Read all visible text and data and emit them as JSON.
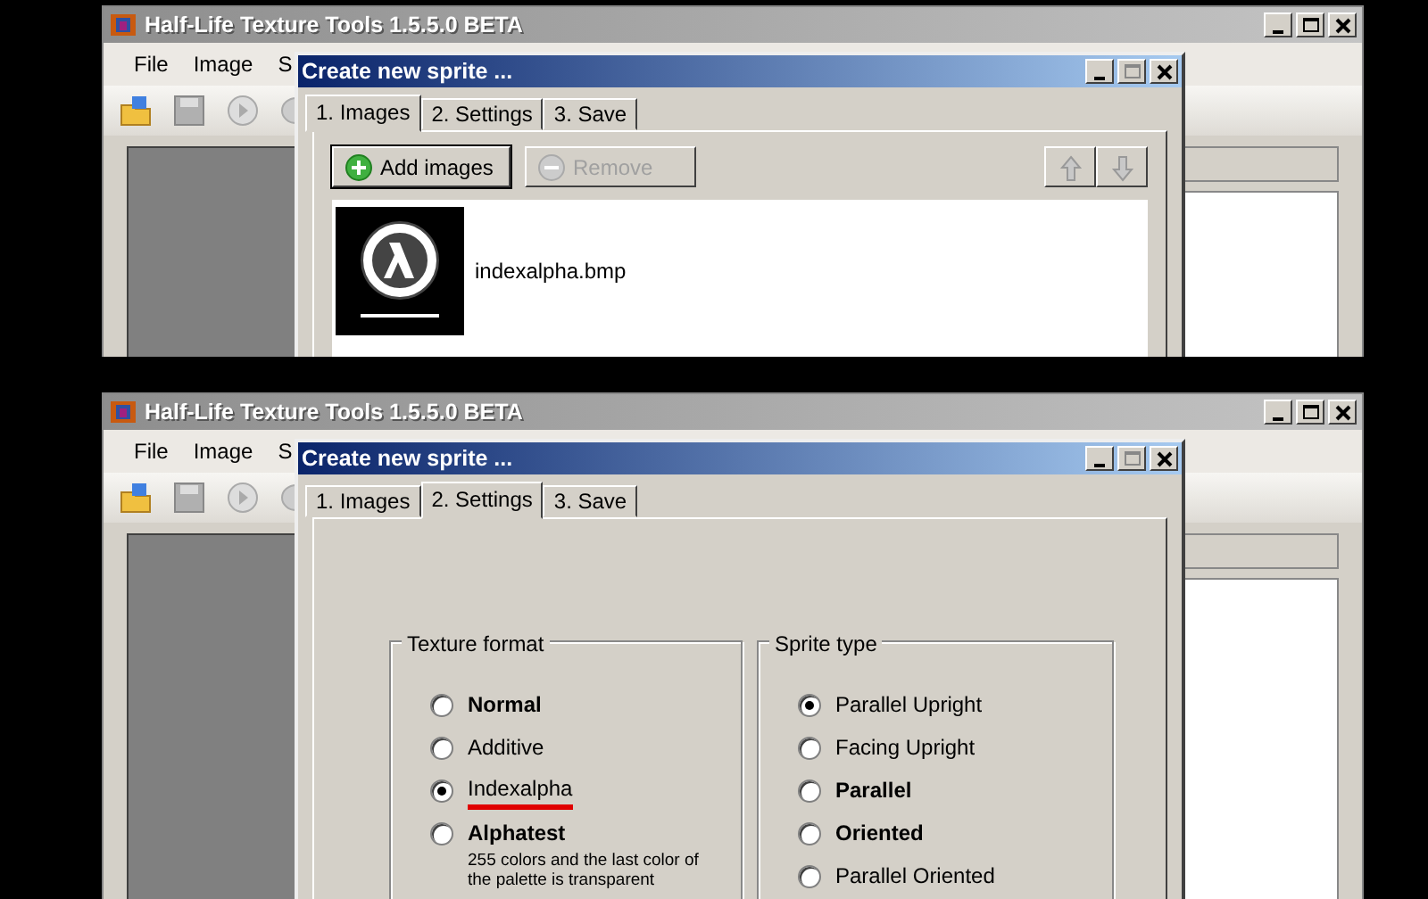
{
  "panels": [
    {
      "app": {
        "title": "Half-Life Texture Tools 1.5.5.0 BETA",
        "menu": [
          "File",
          "Image",
          "S"
        ]
      },
      "dialog": {
        "title": "Create new sprite ...",
        "tabs": [
          {
            "label": "1. Images",
            "selected": true
          },
          {
            "label": "2. Settings",
            "selected": false
          },
          {
            "label": "3. Save",
            "selected": false
          }
        ],
        "page": {
          "kind": "images",
          "buttons": [
            {
              "kind": "add",
              "label": "Add images",
              "disabled": false
            },
            {
              "kind": "remove",
              "label": "Remove",
              "disabled": true
            },
            {
              "kind": "up",
              "disabled": true
            },
            {
              "kind": "down",
              "disabled": true
            }
          ],
          "files": [
            {
              "name": "indexalpha.bmp"
            }
          ]
        }
      }
    },
    {
      "app": {
        "title": "Half-Life Texture Tools 1.5.5.0 BETA",
        "menu": [
          "File",
          "Image",
          "S"
        ]
      },
      "dialog": {
        "title": "Create new sprite ...",
        "tabs": [
          {
            "label": "1. Images",
            "selected": false
          },
          {
            "label": "2. Settings",
            "selected": true
          },
          {
            "label": "3. Save",
            "selected": false
          }
        ],
        "page": {
          "kind": "settings",
          "groups": [
            {
              "title": "Texture format",
              "options": [
                {
                  "label": "Normal",
                  "bold": true,
                  "selected": false
                },
                {
                  "label": "Additive",
                  "bold": false,
                  "selected": false
                },
                {
                  "label": "Indexalpha",
                  "bold": false,
                  "selected": true,
                  "underlined": true
                },
                {
                  "label": "Alphatest",
                  "bold": true,
                  "selected": false,
                  "description": "255 colors and the last color of the palette is transparent"
                }
              ]
            },
            {
              "title": "Sprite type",
              "options": [
                {
                  "label": "Parallel Upright",
                  "bold": false,
                  "selected": true
                },
                {
                  "label": "Facing Upright",
                  "bold": false,
                  "selected": false
                },
                {
                  "label": "Parallel",
                  "bold": true,
                  "selected": false
                },
                {
                  "label": "Oriented",
                  "bold": true,
                  "selected": false
                },
                {
                  "label": "Parallel Oriented",
                  "bold": false,
                  "selected": false
                }
              ]
            }
          ]
        }
      }
    }
  ]
}
